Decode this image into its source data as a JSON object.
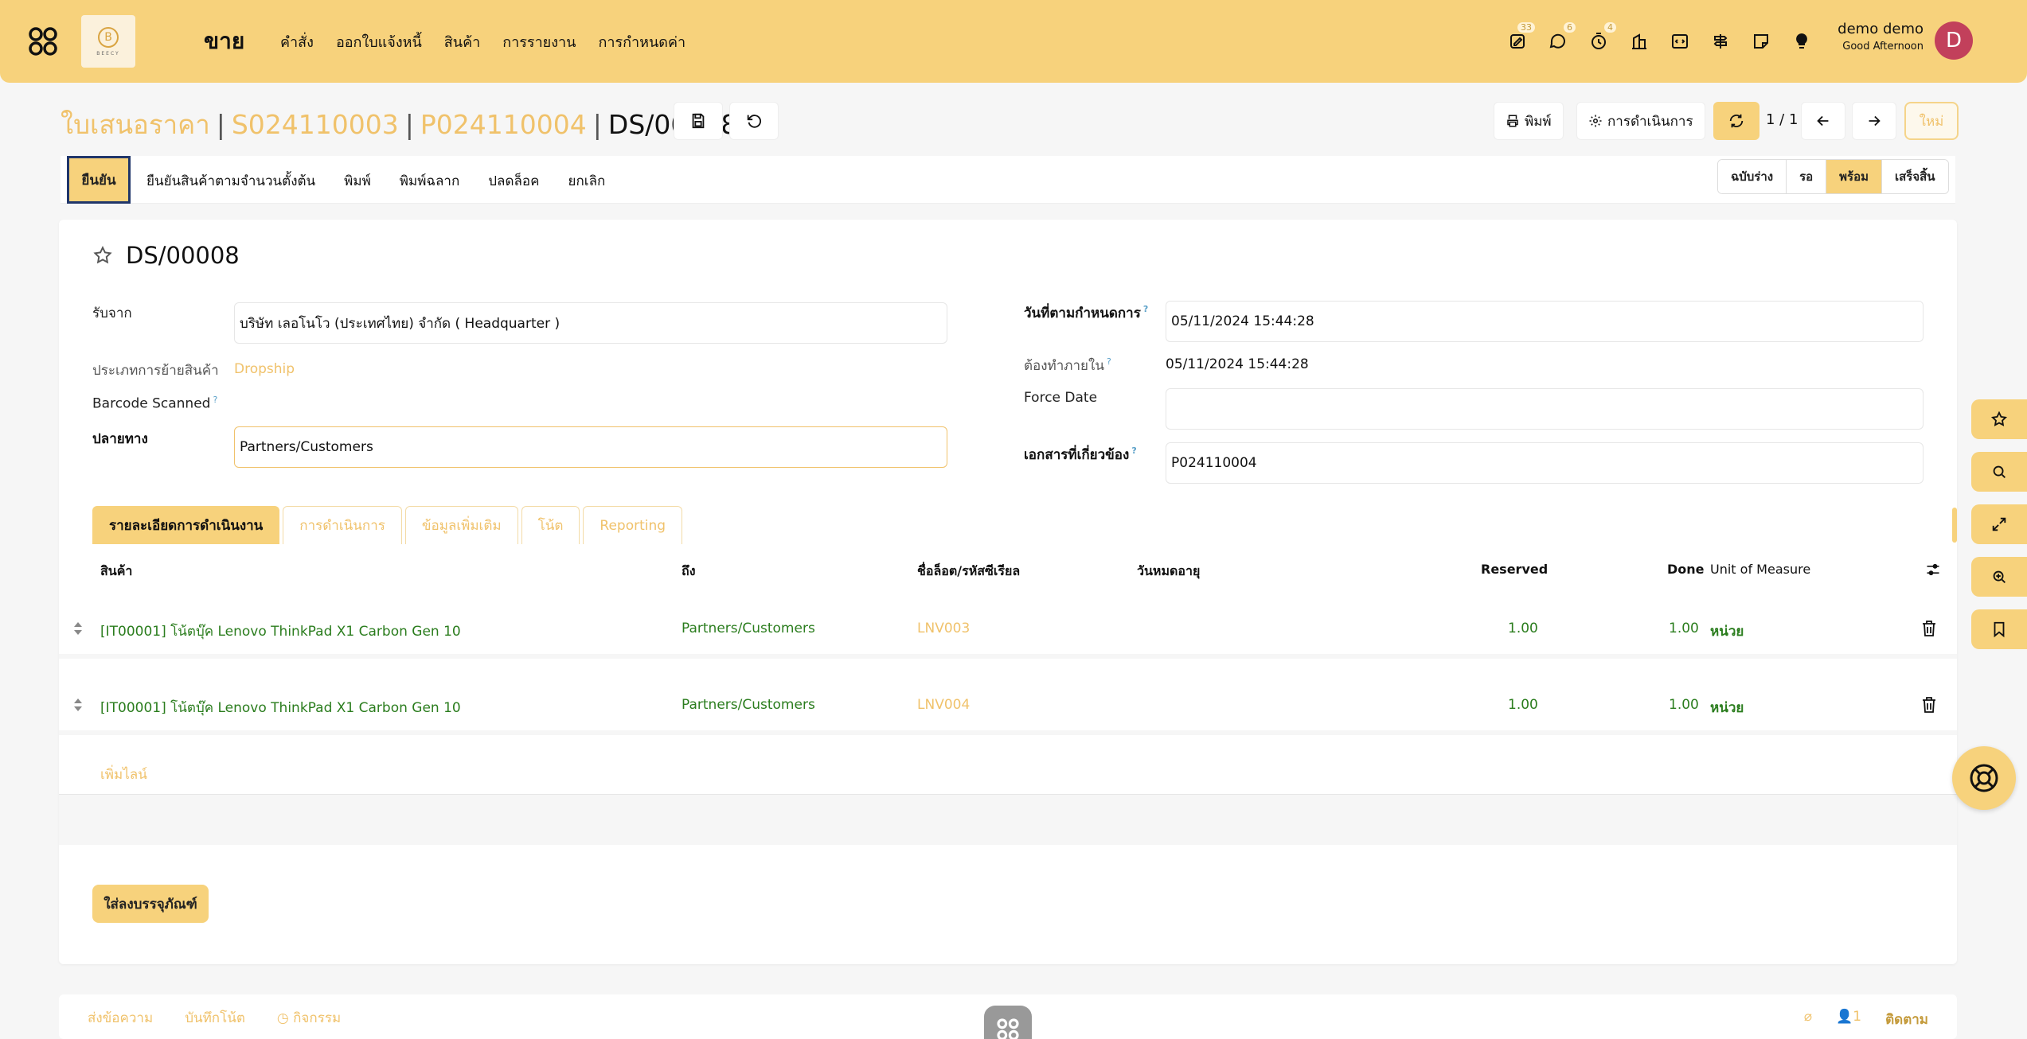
{
  "nav": {
    "brand": "ขาย",
    "logo_text": "BEECY",
    "menu": [
      "คำสั่ง",
      "ออกใบแจ้งหนี้",
      "สินค้า",
      "การรายงาน",
      "การกำหนดค่า"
    ],
    "counts": {
      "activity": "33",
      "messages": "6",
      "timers": "4"
    },
    "user_name": "demo demo",
    "greeting": "Good Afternoon",
    "avatar_letter": "D"
  },
  "breadcrumb": {
    "items": [
      "ใบเสนอราคา",
      "S024110003",
      "P024110004"
    ],
    "current": "DS/00008"
  },
  "controls": {
    "print": "พิมพ์",
    "action": "การดำเนินการ",
    "pager": "1 / 1",
    "new": "ใหม่"
  },
  "actions": {
    "confirm": "ยืนยัน",
    "items": [
      "ยืนยันสินค้าตามจำนวนตั้งต้น",
      "พิมพ์",
      "พิมพ์ฉลาก",
      "ปลดล็อค",
      "ยกเลิก"
    ]
  },
  "statusbar": {
    "steps": [
      "ฉบับร่าง",
      "รอ",
      "พร้อม",
      "เสร็จสิ้น"
    ],
    "active": "พร้อม"
  },
  "form": {
    "title": "DS/00008",
    "receive_from_label": "รับจาก",
    "receive_from": "บริษัท เลอโนโว (ประเทศไทย) จำกัด  ( Headquarter )",
    "op_type_label": "ประเภทการย้ายสินค้า",
    "op_type": "Dropship",
    "barcode_label": "Barcode Scanned",
    "dest_label": "ปลายทาง",
    "dest": "Partners/Customers",
    "scheduled_label": "วันที่ตามกำหนดการ",
    "scheduled": "05/11/2024 15:44:28",
    "deadline_label": "ต้องทำภายใน",
    "deadline": "05/11/2024 15:44:28",
    "force_date_label": "Force Date",
    "force_date": "",
    "source_doc_label": "เอกสารที่เกี่ยวข้อง",
    "source_doc": "P024110004",
    "help_mark": "?"
  },
  "tabs": [
    "รายละเอียดการดำเนินงาน",
    "การดำเนินการ",
    "ข้อมูลเพิ่มเติม",
    "โน้ต",
    "Reporting"
  ],
  "table": {
    "headers": [
      "สินค้า",
      "ถึง",
      "ชื่อล็อต/รหัสซีเรียล",
      "วันหมดอายุ",
      "Reserved",
      "Done",
      "Unit of Measure"
    ],
    "rows": [
      {
        "product": "[IT00001] โน้ตบุ๊ค Lenovo ThinkPad X1 Carbon Gen 10",
        "to": "Partners/Customers",
        "lot": "LNV003",
        "expiry": "",
        "reserved": "1.00",
        "done": "1.00",
        "uom": "หน่วย"
      },
      {
        "product": "[IT00001] โน้ตบุ๊ค Lenovo ThinkPad X1 Carbon Gen 10",
        "to": "Partners/Customers",
        "lot": "LNV004",
        "expiry": "",
        "reserved": "1.00",
        "done": "1.00",
        "uom": "หน่วย"
      }
    ],
    "add_line": "เพิ่มไลน์"
  },
  "put_in_pack": "ใส่ลงบรรจุภัณฑ์",
  "chatter": {
    "send": "ส่งข้อความ",
    "note": "บันทึกโน้ต",
    "activity": "กิจกรรม",
    "followers": "1",
    "follow": "ติดตาม"
  },
  "colors": {
    "accent": "#f7d27c",
    "link": "#f0c26b",
    "green": "#2b7d1e",
    "avatar": "#c2405b"
  }
}
